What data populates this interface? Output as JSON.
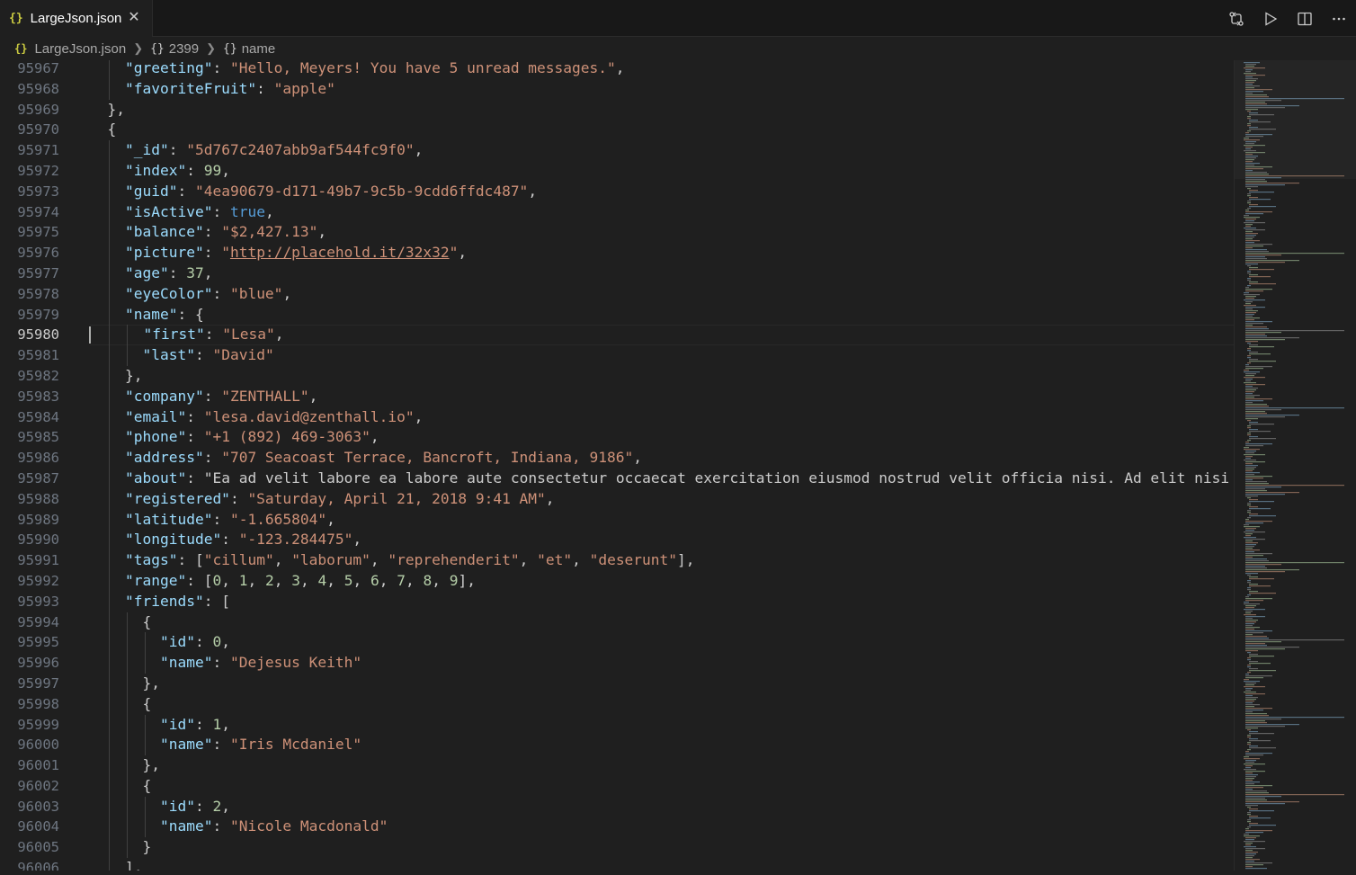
{
  "tab": {
    "label": "LargeJson.json",
    "icon": "json-file-icon"
  },
  "toolbar": {
    "actions": [
      "source-control-compare-icon",
      "run-icon",
      "split-editor-icon",
      "more-actions-icon"
    ]
  },
  "breadcrumb": {
    "file": "LargeJson.json",
    "items": [
      "2399",
      "name"
    ]
  },
  "editor": {
    "active_line": "95980",
    "line_numbers": [
      "95967",
      "95968",
      "95969",
      "95970",
      "95971",
      "95972",
      "95973",
      "95974",
      "95975",
      "95976",
      "95977",
      "95978",
      "95979",
      "95980",
      "95981",
      "95982",
      "95983",
      "95984",
      "95985",
      "95986",
      "95987",
      "95988",
      "95989",
      "95990",
      "95991",
      "95992",
      "95993",
      "95994",
      "95995",
      "95996",
      "95997",
      "95998",
      "95999",
      "96000",
      "96001",
      "96002",
      "96003",
      "96004",
      "96005",
      "96006"
    ],
    "lines": [
      "    \"greeting\": \"Hello, Meyers! You have 5 unread messages.\",",
      "    \"favoriteFruit\": \"apple\"",
      "  },",
      "  {",
      "    \"_id\": \"5d767c2407abb9af544fc9f0\",",
      "    \"index\": 99,",
      "    \"guid\": \"4ea90679-d171-49b7-9c5b-9cdd6ffdc487\",",
      "    \"isActive\": true,",
      "    \"balance\": \"$2,427.13\",",
      "    \"picture\": \"http://placehold.it/32x32\",",
      "    \"age\": 37,",
      "    \"eyeColor\": \"blue\",",
      "    \"name\": {",
      "      \"first\": \"Lesa\",",
      "      \"last\": \"David\"",
      "    },",
      "    \"company\": \"ZENTHALL\",",
      "    \"email\": \"lesa.david@zenthall.io\",",
      "    \"phone\": \"+1 (892) 469-3063\",",
      "    \"address\": \"707 Seacoast Terrace, Bancroft, Indiana, 9186\",",
      "    \"about\": \"Ea ad velit labore ea labore aute consectetur occaecat exercitation eiusmod nostrud velit officia nisi. Ad elit nisi",
      "    \"registered\": \"Saturday, April 21, 2018 9:41 AM\",",
      "    \"latitude\": \"-1.665804\",",
      "    \"longitude\": \"-123.284475\",",
      "    \"tags\": [\"cillum\", \"laborum\", \"reprehenderit\", \"et\", \"deserunt\"],",
      "    \"range\": [0, 1, 2, 3, 4, 5, 6, 7, 8, 9],",
      "    \"friends\": [",
      "      {",
      "        \"id\": 0,",
      "        \"name\": \"Dejesus Keith\"",
      "      },",
      "      {",
      "        \"id\": 1,",
      "        \"name\": \"Iris Mcdaniel\"",
      "      },",
      "      {",
      "        \"id\": 2,",
      "        \"name\": \"Nicole Macdonald\"",
      "      }",
      "    ],"
    ]
  },
  "colors": {
    "key": "#9cdcfe",
    "string": "#ce9178",
    "number": "#b5cea8",
    "boolean": "#569cd6",
    "background": "#1f1f1f"
  }
}
